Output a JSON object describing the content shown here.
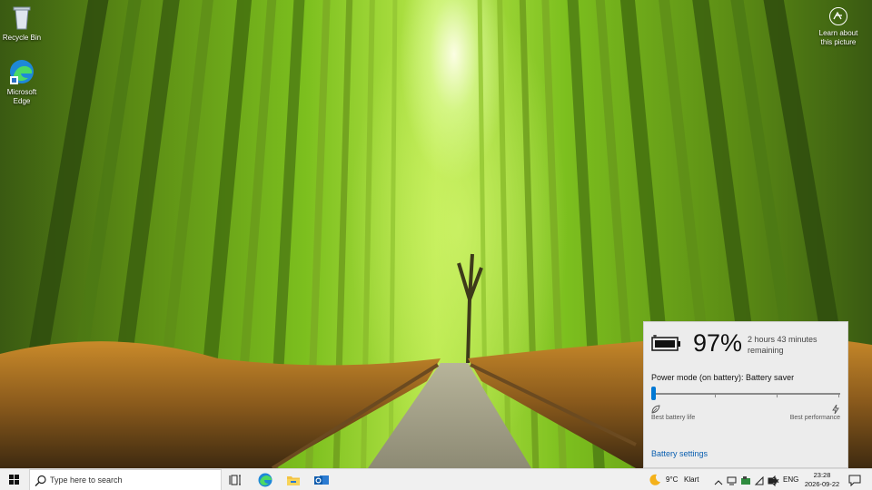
{
  "desktop": {
    "icons": [
      {
        "label": "Recycle Bin",
        "icon": "recycle-bin-icon"
      },
      {
        "label": "Microsoft Edge",
        "icon": "edge-icon"
      }
    ],
    "learn_about": {
      "label_line1": "Learn about",
      "label_line2": "this picture",
      "icon": "camera-icon"
    }
  },
  "battery_flyout": {
    "percent": "97%",
    "remaining_line1": "2 hours 43 minutes",
    "remaining_line2": "remaining",
    "power_mode_label": "Power mode (on battery): Battery saver",
    "slider_level": 0,
    "best_battery_label": "Best battery life",
    "best_performance_label": "Best performance",
    "settings_link": "Battery settings",
    "accent": "#0078d4"
  },
  "taskbar": {
    "search_placeholder": "Type here to search",
    "pinned": [
      "task-view-icon",
      "edge-icon",
      "file-explorer-icon",
      "outlook-icon"
    ],
    "weather": {
      "temp": "9°C",
      "condition": "Klart",
      "icon": "moon-icon"
    },
    "tray_icons": [
      "chevron-up-icon",
      "network-icon",
      "security-icon",
      "wifi-icon",
      "battery-icon",
      "volume-icon"
    ],
    "language": "ENG",
    "time": "23:28",
    "date": "2026-09-22",
    "notification_icon": "notification-icon"
  }
}
